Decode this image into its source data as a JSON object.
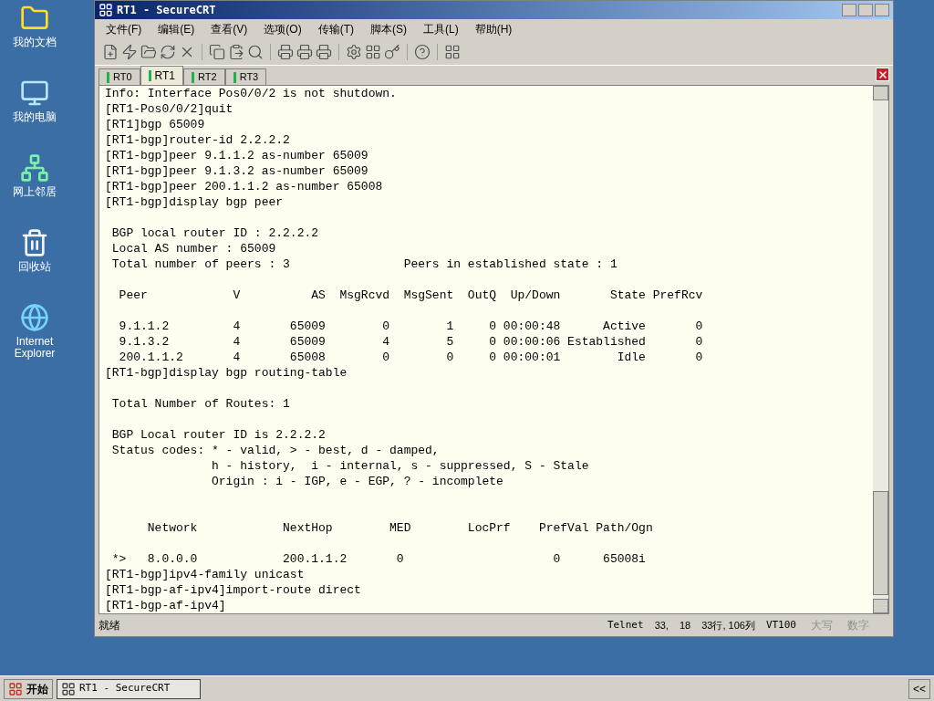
{
  "desktop_icons": [
    {
      "label": "我的文档",
      "kind": "documents"
    },
    {
      "label": "我的电脑",
      "kind": "computer"
    },
    {
      "label": "网上邻居",
      "kind": "network"
    },
    {
      "label": "回收站",
      "kind": "recycle"
    },
    {
      "label": "Internet Explorer",
      "kind": "browser"
    }
  ],
  "window": {
    "title": "RT1 - SecureCRT"
  },
  "menu": [
    {
      "label": "文件(F)"
    },
    {
      "label": "编辑(E)"
    },
    {
      "label": "查看(V)"
    },
    {
      "label": "选项(O)"
    },
    {
      "label": "传输(T)"
    },
    {
      "label": "脚本(S)"
    },
    {
      "label": "工具(L)"
    },
    {
      "label": "帮助(H)"
    }
  ],
  "tabs": [
    {
      "label": "RT0",
      "selected": false
    },
    {
      "label": "RT1",
      "selected": true
    },
    {
      "label": "RT2",
      "selected": false
    },
    {
      "label": "RT3",
      "selected": false
    }
  ],
  "terminal": {
    "lines": [
      {
        "kind": "text",
        "text": "Info: Interface Pos0/0/2 is not shutdown."
      },
      {
        "kind": "text",
        "text": "[RT1-Pos0/0/2]quit"
      },
      {
        "kind": "text",
        "text": "[RT1]bgp 65009"
      },
      {
        "kind": "text",
        "text": "[RT1-bgp]router-id 2.2.2.2"
      },
      {
        "kind": "text",
        "text": "[RT1-bgp]peer 9.1.1.2 as-number 65009"
      },
      {
        "kind": "text",
        "text": "[RT1-bgp]peer 9.1.3.2 as-number 65009"
      },
      {
        "kind": "text",
        "text": "[RT1-bgp]peer 200.1.1.2 as-number 65008"
      },
      {
        "kind": "text",
        "text": "[RT1-bgp]display bgp peer"
      },
      {
        "kind": "blank"
      },
      {
        "kind": "text",
        "text": " BGP local router ID : 2.2.2.2"
      },
      {
        "kind": "text",
        "text": " Local AS number : 65009"
      },
      {
        "kind": "text",
        "text": " Total number of peers : 3                Peers in established state : 1"
      },
      {
        "kind": "blank"
      },
      {
        "kind": "text",
        "text": "  Peer            V          AS  MsgRcvd  MsgSent  OutQ  Up/Down       State PrefRcv"
      },
      {
        "kind": "blank"
      },
      {
        "kind": "text",
        "text": "  9.1.1.2         4       65009        0        1     0 00:00:48      Active       0"
      },
      {
        "kind": "text",
        "text": "  9.1.3.2         4       65009        4        5     0 00:00:06 Established       0"
      },
      {
        "kind": "text",
        "text": "  200.1.1.2       4       65008        0        0     0 00:00:01        Idle       0"
      },
      {
        "kind": "text",
        "text": "[RT1-bgp]display bgp routing-table"
      },
      {
        "kind": "blank"
      },
      {
        "kind": "text",
        "text": " Total Number of Routes: 1"
      },
      {
        "kind": "blank"
      },
      {
        "kind": "text",
        "text": " BGP Local router ID is 2.2.2.2"
      },
      {
        "kind": "text",
        "text": " Status codes: * - valid, > - best, d - damped,"
      },
      {
        "kind": "text",
        "text": "               h - history,  i - internal, s - suppressed, S - Stale"
      },
      {
        "kind": "text",
        "text": "               Origin : i - IGP, e - EGP, ? - incomplete"
      },
      {
        "kind": "blank"
      },
      {
        "kind": "blank"
      },
      {
        "kind": "text",
        "text": "      Network            NextHop        MED        LocPrf    PrefVal Path/Ogn"
      },
      {
        "kind": "blank"
      },
      {
        "kind": "text",
        "text": " *>   8.0.0.0            200.1.1.2       0                     0      65008i"
      },
      {
        "kind": "text",
        "text": "[RT1-bgp]ipv4-family unicast"
      },
      {
        "kind": "text",
        "text": "[RT1-bgp-af-ipv4]import-route direct"
      },
      {
        "kind": "text",
        "text": "[RT1-bgp-af-ipv4]"
      }
    ]
  },
  "status_bar": {
    "message": "就绪",
    "protocol": "Telnet",
    "cursor_row": "33,",
    "cursor_col": "18",
    "size": "33行, 106列",
    "emulation": "VT100",
    "indicators": [
      {
        "label": "大写",
        "active": false
      },
      {
        "label": "数字",
        "active": false
      }
    ]
  },
  "taskbar": {
    "start": "开始",
    "tasks": [
      {
        "label": "RT1 - SecureCRT",
        "selected": true
      }
    ],
    "tray_toggle": "<<"
  }
}
